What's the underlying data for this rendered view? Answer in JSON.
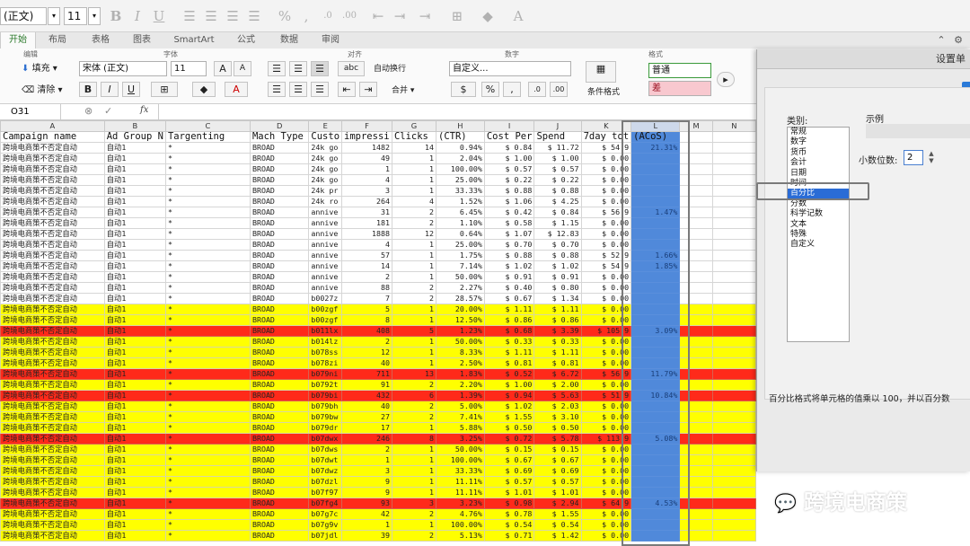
{
  "toolbar": {
    "font_name": "(正文)",
    "font_size": "11"
  },
  "tabs": [
    {
      "label": "开始"
    },
    {
      "label": "布局"
    },
    {
      "label": "表格"
    },
    {
      "label": "图表"
    },
    {
      "label": "SmartArt"
    },
    {
      "label": "公式"
    },
    {
      "label": "数据"
    },
    {
      "label": "审阅"
    }
  ],
  "ribbon": {
    "groups": {
      "edit": "编辑",
      "font": "字体",
      "align": "对齐",
      "number": "数字",
      "format": "格式"
    },
    "fill": "填充",
    "clear": "清除",
    "font_name": "宋体 (正文)",
    "font_size": "11",
    "wrap": "自动换行",
    "merge": "合并",
    "number_format": "自定义...",
    "conditional": "条件格式",
    "style_normal": "普通",
    "style_bad": "差"
  },
  "formula": {
    "cell_ref": "O31",
    "fx": "fx"
  },
  "grid": {
    "col_letters": [
      "A",
      "B",
      "C",
      "D",
      "E",
      "F",
      "G",
      "H",
      "I",
      "J",
      "K",
      "L",
      "M",
      "N"
    ],
    "headers": [
      "Campaign name",
      "Ad Group N",
      "Targenting",
      "Mach Type",
      "Custo",
      "impressi",
      "Clicks",
      "(CTR)",
      "Cost Per",
      "Spend",
      "7day tot",
      "(ACoS)",
      "",
      ""
    ],
    "rows": [
      {
        "s": "w",
        "c": [
          "跨境电商策不否定自动",
          "自动1",
          "*",
          "BROAD",
          "24k go",
          "1482",
          "14",
          "0.94%",
          "$ 0.84",
          "$ 11.72",
          "$ 54.9",
          "21.31%"
        ]
      },
      {
        "s": "w",
        "c": [
          "跨境电商策不否定自动",
          "自动1",
          "*",
          "BROAD",
          "24k go",
          "49",
          "1",
          "2.04%",
          "$ 1.00",
          "$ 1.00",
          "$ 0.00",
          ""
        ]
      },
      {
        "s": "w",
        "c": [
          "跨境电商策不否定自动",
          "自动1",
          "*",
          "BROAD",
          "24k go",
          "1",
          "1",
          "100.00%",
          "$ 0.57",
          "$ 0.57",
          "$ 0.00",
          ""
        ]
      },
      {
        "s": "w",
        "c": [
          "跨境电商策不否定自动",
          "自动1",
          "*",
          "BROAD",
          "24k go",
          "4",
          "1",
          "25.00%",
          "$ 0.22",
          "$ 0.22",
          "$ 0.00",
          ""
        ]
      },
      {
        "s": "w",
        "c": [
          "跨境电商策不否定自动",
          "自动1",
          "*",
          "BROAD",
          "24k pr",
          "3",
          "1",
          "33.33%",
          "$ 0.88",
          "$ 0.88",
          "$ 0.00",
          ""
        ]
      },
      {
        "s": "w",
        "c": [
          "跨境电商策不否定自动",
          "自动1",
          "*",
          "BROAD",
          "24k ro",
          "264",
          "4",
          "1.52%",
          "$ 1.06",
          "$ 4.25",
          "$ 0.00",
          ""
        ]
      },
      {
        "s": "w",
        "c": [
          "跨境电商策不否定自动",
          "自动1",
          "*",
          "BROAD",
          "annive",
          "31",
          "2",
          "6.45%",
          "$ 0.42",
          "$ 0.84",
          "$ 56.9",
          "1.47%"
        ]
      },
      {
        "s": "w",
        "c": [
          "跨境电商策不否定自动",
          "自动1",
          "*",
          "BROAD",
          "annive",
          "181",
          "2",
          "1.10%",
          "$ 0.58",
          "$ 1.15",
          "$ 0.00",
          ""
        ]
      },
      {
        "s": "w",
        "c": [
          "跨境电商策不否定自动",
          "自动1",
          "*",
          "BROAD",
          "annive",
          "1888",
          "12",
          "0.64%",
          "$ 1.07",
          "$ 12.83",
          "$ 0.00",
          ""
        ]
      },
      {
        "s": "w",
        "c": [
          "跨境电商策不否定自动",
          "自动1",
          "*",
          "BROAD",
          "annive",
          "4",
          "1",
          "25.00%",
          "$ 0.70",
          "$ 0.70",
          "$ 0.00",
          ""
        ]
      },
      {
        "s": "w",
        "c": [
          "跨境电商策不否定自动",
          "自动1",
          "*",
          "BROAD",
          "annive",
          "57",
          "1",
          "1.75%",
          "$ 0.88",
          "$ 0.88",
          "$ 52.9",
          "1.66%"
        ]
      },
      {
        "s": "w",
        "c": [
          "跨境电商策不否定自动",
          "自动1",
          "*",
          "BROAD",
          "annive",
          "14",
          "1",
          "7.14%",
          "$ 1.02",
          "$ 1.02",
          "$ 54.9",
          "1.85%"
        ]
      },
      {
        "s": "w",
        "c": [
          "跨境电商策不否定自动",
          "自动1",
          "*",
          "BROAD",
          "annive",
          "2",
          "1",
          "50.00%",
          "$ 0.91",
          "$ 0.91",
          "$ 0.00",
          ""
        ]
      },
      {
        "s": "w",
        "c": [
          "跨境电商策不否定自动",
          "自动1",
          "*",
          "BROAD",
          "annive",
          "88",
          "2",
          "2.27%",
          "$ 0.40",
          "$ 0.80",
          "$ 0.00",
          ""
        ]
      },
      {
        "s": "w",
        "c": [
          "跨境电商策不否定自动",
          "自动1",
          "*",
          "BROAD",
          "b0027z",
          "7",
          "2",
          "28.57%",
          "$ 0.67",
          "$ 1.34",
          "$ 0.00",
          ""
        ]
      },
      {
        "s": "y",
        "c": [
          "跨境电商策不否定自动",
          "自动1",
          "*",
          "BROAD",
          "b00zgf",
          "5",
          "1",
          "20.00%",
          "$ 1.11",
          "$ 1.11",
          "$ 0.00",
          ""
        ]
      },
      {
        "s": "y",
        "c": [
          "跨境电商策不否定自动",
          "自动1",
          "*",
          "BROAD",
          "b00zgf",
          "8",
          "1",
          "12.50%",
          "$ 0.86",
          "$ 0.86",
          "$ 0.00",
          ""
        ]
      },
      {
        "s": "r",
        "c": [
          "跨境电商策不否定自动",
          "自动1",
          "*",
          "BROAD",
          "b011lx",
          "408",
          "5",
          "1.23%",
          "$ 0.68",
          "$ 3.39",
          "$ 105.9",
          "3.09%"
        ]
      },
      {
        "s": "y",
        "c": [
          "跨境电商策不否定自动",
          "自动1",
          "*",
          "BROAD",
          "b014lz",
          "2",
          "1",
          "50.00%",
          "$ 0.33",
          "$ 0.33",
          "$ 0.00",
          ""
        ]
      },
      {
        "s": "y",
        "c": [
          "跨境电商策不否定自动",
          "自动1",
          "*",
          "BROAD",
          "b078ss",
          "12",
          "1",
          "8.33%",
          "$ 1.11",
          "$ 1.11",
          "$ 0.00",
          ""
        ]
      },
      {
        "s": "y",
        "c": [
          "跨境电商策不否定自动",
          "自动1",
          "*",
          "BROAD",
          "b078zi",
          "40",
          "1",
          "2.50%",
          "$ 0.81",
          "$ 0.81",
          "$ 0.00",
          ""
        ]
      },
      {
        "s": "r",
        "c": [
          "跨境电商策不否定自动",
          "自动1",
          "*",
          "BROAD",
          "b079ni",
          "711",
          "13",
          "1.83%",
          "$ 0.52",
          "$ 6.72",
          "$ 56.9",
          "11.79%"
        ]
      },
      {
        "s": "y",
        "c": [
          "跨境电商策不否定自动",
          "自动1",
          "*",
          "BROAD",
          "b0792t",
          "91",
          "2",
          "2.20%",
          "$ 1.00",
          "$ 2.00",
          "$ 0.00",
          ""
        ]
      },
      {
        "s": "r",
        "c": [
          "跨境电商策不否定自动",
          "自动1",
          "*",
          "BROAD",
          "b079bi",
          "432",
          "6",
          "1.39%",
          "$ 0.94",
          "$ 5.63",
          "$ 51.9",
          "10.84%"
        ]
      },
      {
        "s": "y",
        "c": [
          "跨境电商策不否定自动",
          "自动1",
          "*",
          "BROAD",
          "b079bh",
          "40",
          "2",
          "5.00%",
          "$ 1.02",
          "$ 2.03",
          "$ 0.00",
          ""
        ]
      },
      {
        "s": "y",
        "c": [
          "跨境电商策不否定自动",
          "自动1",
          "*",
          "BROAD",
          "b079bw",
          "27",
          "2",
          "7.41%",
          "$ 1.55",
          "$ 3.10",
          "$ 0.00",
          ""
        ]
      },
      {
        "s": "y",
        "c": [
          "跨境电商策不否定自动",
          "自动1",
          "*",
          "BROAD",
          "b079dr",
          "17",
          "1",
          "5.88%",
          "$ 0.50",
          "$ 0.50",
          "$ 0.00",
          ""
        ]
      },
      {
        "s": "r",
        "c": [
          "跨境电商策不否定自动",
          "自动1",
          "*",
          "BROAD",
          "b07dwx",
          "246",
          "8",
          "3.25%",
          "$ 0.72",
          "$ 5.78",
          "$ 113.9",
          "5.08%"
        ]
      },
      {
        "s": "y",
        "c": [
          "跨境电商策不否定自动",
          "自动1",
          "*",
          "BROAD",
          "b07dws",
          "2",
          "1",
          "50.00%",
          "$ 0.15",
          "$ 0.15",
          "$ 0.00",
          ""
        ]
      },
      {
        "s": "y",
        "c": [
          "跨境电商策不否定自动",
          "自动1",
          "*",
          "BROAD",
          "b07dwt",
          "1",
          "1",
          "100.00%",
          "$ 0.67",
          "$ 0.67",
          "$ 0.00",
          ""
        ]
      },
      {
        "s": "y",
        "c": [
          "跨境电商策不否定自动",
          "自动1",
          "*",
          "BROAD",
          "b07dwz",
          "3",
          "1",
          "33.33%",
          "$ 0.69",
          "$ 0.69",
          "$ 0.00",
          ""
        ]
      },
      {
        "s": "y",
        "c": [
          "跨境电商策不否定自动",
          "自动1",
          "*",
          "BROAD",
          "b07dzl",
          "9",
          "1",
          "11.11%",
          "$ 0.57",
          "$ 0.57",
          "$ 0.00",
          ""
        ]
      },
      {
        "s": "y",
        "c": [
          "跨境电商策不否定自动",
          "自动1",
          "*",
          "BROAD",
          "b07f97",
          "9",
          "1",
          "11.11%",
          "$ 1.01",
          "$ 1.01",
          "$ 0.00",
          ""
        ]
      },
      {
        "s": "r",
        "c": [
          "跨境电商策不否定自动",
          "自动1",
          "*",
          "BROAD",
          "b07fg4",
          "93",
          "3",
          "3.23%",
          "$ 0.98",
          "$ 2.94",
          "$ 64.9",
          "4.53%"
        ]
      },
      {
        "s": "y",
        "c": [
          "跨境电商策不否定自动",
          "自动1",
          "*",
          "BROAD",
          "b07g7c",
          "42",
          "2",
          "4.76%",
          "$ 0.78",
          "$ 1.55",
          "$ 0.00",
          ""
        ]
      },
      {
        "s": "y",
        "c": [
          "跨境电商策不否定自动",
          "自动1",
          "*",
          "BROAD",
          "b07g9v",
          "1",
          "1",
          "100.00%",
          "$ 0.54",
          "$ 0.54",
          "$ 0.00",
          ""
        ]
      },
      {
        "s": "y",
        "c": [
          "跨境电商策不否定自动",
          "自动1",
          "*",
          "BROAD",
          "b07jdl",
          "39",
          "2",
          "5.13%",
          "$ 0.71",
          "$ 1.42",
          "$ 0.00",
          ""
        ]
      }
    ]
  },
  "dialog": {
    "title": "设置单",
    "category_label": "类别:",
    "categories": [
      "常规",
      "数字",
      "货币",
      "会计",
      "日期",
      "时间",
      "百分比",
      "分数",
      "科学记数",
      "文本",
      "特殊",
      "自定义"
    ],
    "selected_category": "百分比",
    "sample_label": "示例",
    "decimals_label": "小数位数:",
    "decimals_value": "2",
    "description": "百分比格式将单元格的值乘以 100，并以百分数"
  },
  "watermark": "跨境电商策"
}
